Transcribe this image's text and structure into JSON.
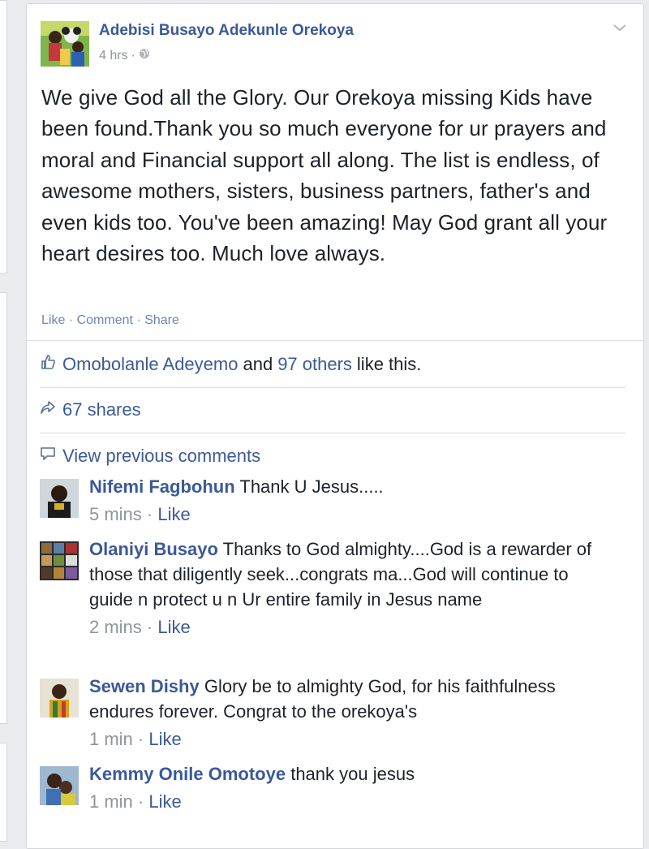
{
  "post": {
    "author": "Adebisi Busayo Adekunle Orekoya",
    "time": "4 hrs",
    "text": "We give God all the Glory. Our Orekoya missing Kids have been found.Thank you so much everyone for ur prayers and moral and Financial support all along. The list is endless, of awesome mothers, sisters, business partners, father's and even kids too. You've been amazing! May God grant all your heart desires too. Much love always.",
    "actions": {
      "like": "Like",
      "comment": "Comment",
      "share": "Share",
      "separator": "·"
    }
  },
  "likes": {
    "name": "Omobolanle Adeyemo",
    "and": "and",
    "others": "97 others",
    "suffix": "like this."
  },
  "shares": {
    "label": "67 shares"
  },
  "view_previous": "View previous comments",
  "comments": [
    {
      "name": "Nifemi Fagbohun",
      "text": "Thank U Jesus.....",
      "time": "5 mins",
      "like": "Like"
    },
    {
      "name": "Olaniyi Busayo",
      "text": "Thanks to God almighty....God is a rewarder of those that diligently seek...congrats ma...God will continue to guide n protect u n Ur entire family in Jesus name",
      "time": "2 mins",
      "like": "Like"
    },
    {
      "name": "Sewen Dishy",
      "text": "Glory be to almighty God, for his faithfulness endures forever. Congrat to the orekoya's",
      "time": "1 min",
      "like": "Like"
    },
    {
      "name": "Kemmy Onile Omotoye",
      "text": "thank you jesus",
      "time": "1 min",
      "like": "Like"
    }
  ],
  "icons": {
    "chevron": "chevron-down-icon",
    "globe": "globe-icon",
    "like": "thumbs-up-icon",
    "share": "share-arrow-icon",
    "comment": "comment-bubble-icon"
  },
  "colors": {
    "link": "#3b5998",
    "text": "#1d2129",
    "muted": "#90949c",
    "background": "#e9ebee"
  }
}
